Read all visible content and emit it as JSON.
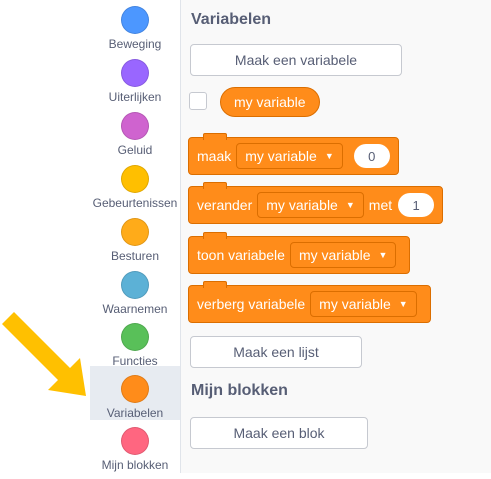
{
  "categories": [
    {
      "label": "Beweging",
      "color": "#4c97ff"
    },
    {
      "label": "Uiterlijken",
      "color": "#9966ff"
    },
    {
      "label": "Geluid",
      "color": "#cf63cf"
    },
    {
      "label": "Gebeurtenissen",
      "color": "#ffbf00"
    },
    {
      "label": "Besturen",
      "color": "#ffab19"
    },
    {
      "label": "Waarnemen",
      "color": "#5cb1d6"
    },
    {
      "label": "Functies",
      "color": "#59c059"
    },
    {
      "label": "Variabelen",
      "color": "#ff8c1a"
    },
    {
      "label": "Mijn blokken",
      "color": "#ff6680"
    }
  ],
  "selected_category": "Variabelen",
  "flyout": {
    "variables_heading": "Variabelen",
    "make_variable_button": "Maak een variabele",
    "variable_reporter": "my variable",
    "blocks": {
      "set": {
        "label": "maak",
        "dropdown": "my variable",
        "value": "0"
      },
      "change": {
        "label": "verander",
        "dropdown": "my variable",
        "by_label": "met",
        "value": "1"
      },
      "show": {
        "label": "toon variabele",
        "dropdown": "my variable"
      },
      "hide": {
        "label": "verberg variabele",
        "dropdown": "my variable"
      }
    },
    "make_list_button": "Maak een lijst",
    "my_blocks_heading": "Mijn blokken",
    "make_block_button": "Maak een blok"
  },
  "annotation": {
    "arrow_color": "#ffc000"
  }
}
